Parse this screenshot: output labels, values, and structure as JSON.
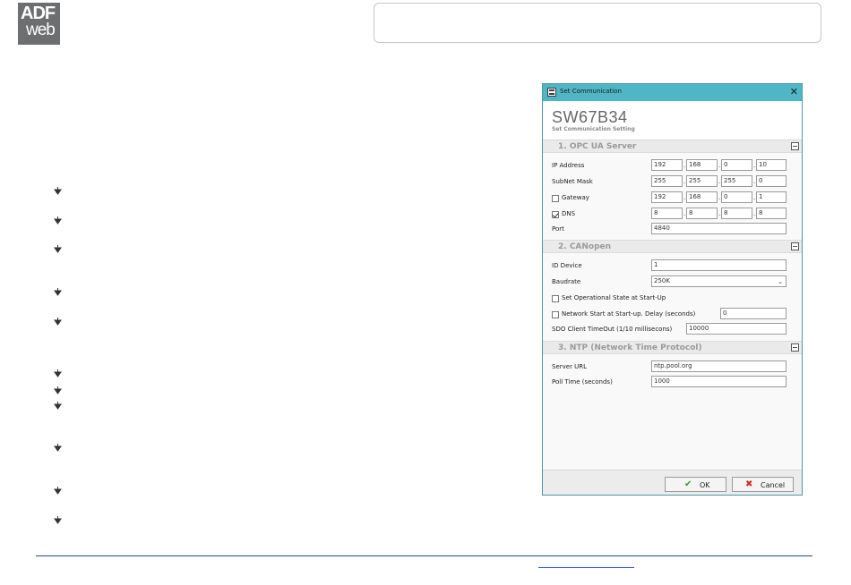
{
  "logo": {
    "line1": "ADF",
    "line2": "web"
  },
  "dialog": {
    "title": "Set Communication",
    "close_glyph": "✕",
    "device_name": "SW67B34",
    "device_subtitle": "Set Communication Setting",
    "sections": {
      "opc": {
        "title": "1. OPC UA Server",
        "ip_label": "IP Address",
        "ip": [
          "192",
          "168",
          "0",
          "10"
        ],
        "subnet_label": "SubNet Mask",
        "subnet": [
          "255",
          "255",
          "255",
          "0"
        ],
        "gateway_label": "Gateway",
        "gateway_checked": false,
        "gateway": [
          "192",
          "168",
          "0",
          "1"
        ],
        "dns_label": "DNS",
        "dns_checked": true,
        "dns": [
          "8",
          "8",
          "8",
          "8"
        ],
        "port_label": "Port",
        "port": "4840"
      },
      "canopen": {
        "title": "2. CANopen",
        "id_label": "ID Device",
        "id_value": "1",
        "baud_label": "Baudrate",
        "baud_value": "250K",
        "set_op_label": "Set Operational State at Start-Up",
        "set_op_checked": false,
        "net_start_label": "Network Start at Start-up. Delay (seconds)",
        "net_start_checked": false,
        "net_start_value": "0",
        "sdo_label": "SDO Client TimeOut (1/10 millisecons)",
        "sdo_value": "10000"
      },
      "ntp": {
        "title": "3. NTP (Network Time Protocol)",
        "url_label": "Server URL",
        "url_value": "ntp.pool.org",
        "poll_label": "Poll Time (seconds)",
        "poll_value": "1000"
      }
    },
    "buttons": {
      "ok": "OK",
      "cancel": "Cancel"
    }
  },
  "colors": {
    "titlebar": "#4fb6c6",
    "footer_line": "#1f4e8c",
    "section_bg": "#eaeaea"
  },
  "icons": {
    "bullet": "bullet-arrow-icon",
    "ok": "check-icon",
    "cancel": "red-x-icon",
    "section_toggle": "collapse-icon"
  }
}
